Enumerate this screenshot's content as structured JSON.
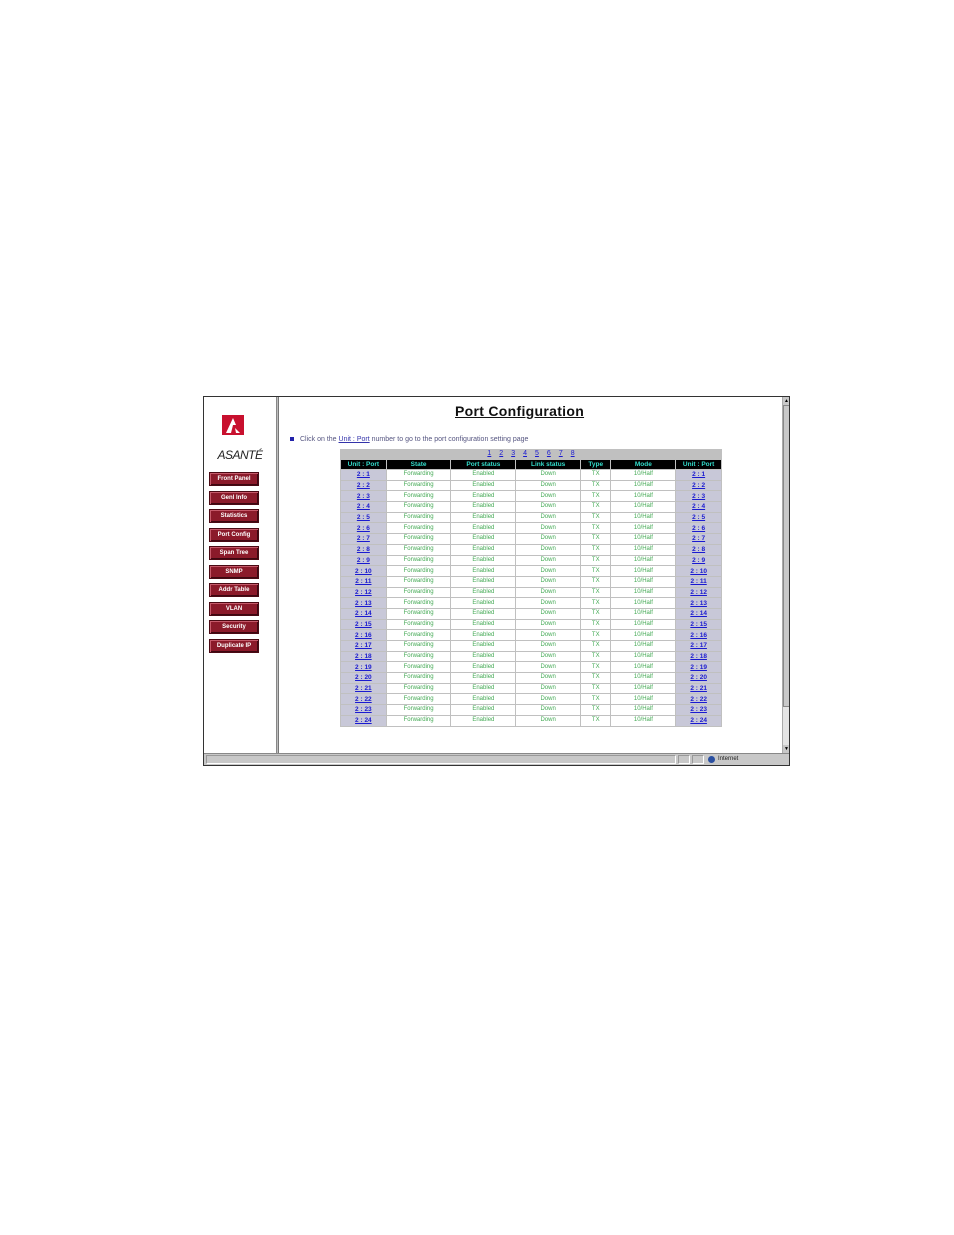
{
  "page": {
    "title": "Port Configuration",
    "instruction_prefix": "Click on the ",
    "instruction_link": "Unit : Port",
    "instruction_suffix": " number to go to the port configuration setting page"
  },
  "logo": {
    "text": "ASANTÉ",
    "icon": "asante-logo-icon"
  },
  "nav": [
    "Front Panel",
    "Genl Info",
    "Statistics",
    "Port Config",
    "Span Tree",
    "SNMP",
    "Addr Table",
    "VLAN",
    "Security",
    "Duplicate IP"
  ],
  "unit_pages": [
    "1",
    "2",
    "3",
    "4",
    "5",
    "6",
    "7",
    "8"
  ],
  "table": {
    "headers": [
      "Unit : Port",
      "State",
      "Port status",
      "Link status",
      "Type",
      "Mode",
      "Unit : Port"
    ],
    "rows": [
      [
        "2 : 1",
        "Forwarding",
        "Enabled",
        "Down",
        "TX",
        "10/Half",
        "2 : 1"
      ],
      [
        "2 : 2",
        "Forwarding",
        "Enabled",
        "Down",
        "TX",
        "10/Half",
        "2 : 2"
      ],
      [
        "2 : 3",
        "Forwarding",
        "Enabled",
        "Down",
        "TX",
        "10/Half",
        "2 : 3"
      ],
      [
        "2 : 4",
        "Forwarding",
        "Enabled",
        "Down",
        "TX",
        "10/Half",
        "2 : 4"
      ],
      [
        "2 : 5",
        "Forwarding",
        "Enabled",
        "Down",
        "TX",
        "10/Half",
        "2 : 5"
      ],
      [
        "2 : 6",
        "Forwarding",
        "Enabled",
        "Down",
        "TX",
        "10/Half",
        "2 : 6"
      ],
      [
        "2 : 7",
        "Forwarding",
        "Enabled",
        "Down",
        "TX",
        "10/Half",
        "2 : 7"
      ],
      [
        "2 : 8",
        "Forwarding",
        "Enabled",
        "Down",
        "TX",
        "10/Half",
        "2 : 8"
      ],
      [
        "2 : 9",
        "Forwarding",
        "Enabled",
        "Down",
        "TX",
        "10/Half",
        "2 : 9"
      ],
      [
        "2 : 10",
        "Forwarding",
        "Enabled",
        "Down",
        "TX",
        "10/Half",
        "2 : 10"
      ],
      [
        "2 : 11",
        "Forwarding",
        "Enabled",
        "Down",
        "TX",
        "10/Half",
        "2 : 11"
      ],
      [
        "2 : 12",
        "Forwarding",
        "Enabled",
        "Down",
        "TX",
        "10/Half",
        "2 : 12"
      ],
      [
        "2 : 13",
        "Forwarding",
        "Enabled",
        "Down",
        "TX",
        "10/Half",
        "2 : 13"
      ],
      [
        "2 : 14",
        "Forwarding",
        "Enabled",
        "Down",
        "TX",
        "10/Half",
        "2 : 14"
      ],
      [
        "2 : 15",
        "Forwarding",
        "Enabled",
        "Down",
        "TX",
        "10/Half",
        "2 : 15"
      ],
      [
        "2 : 16",
        "Forwarding",
        "Enabled",
        "Down",
        "TX",
        "10/Half",
        "2 : 16"
      ],
      [
        "2 : 17",
        "Forwarding",
        "Enabled",
        "Down",
        "TX",
        "10/Half",
        "2 : 17"
      ],
      [
        "2 : 18",
        "Forwarding",
        "Enabled",
        "Down",
        "TX",
        "10/Half",
        "2 : 18"
      ],
      [
        "2 : 19",
        "Forwarding",
        "Enabled",
        "Down",
        "TX",
        "10/Half",
        "2 : 19"
      ],
      [
        "2 : 20",
        "Forwarding",
        "Enabled",
        "Down",
        "TX",
        "10/Half",
        "2 : 20"
      ],
      [
        "2 : 21",
        "Forwarding",
        "Enabled",
        "Down",
        "TX",
        "10/Half",
        "2 : 21"
      ],
      [
        "2 : 22",
        "Forwarding",
        "Enabled",
        "Down",
        "TX",
        "10/Half",
        "2 : 22"
      ],
      [
        "2 : 23",
        "Forwarding",
        "Enabled",
        "Down",
        "TX",
        "10/Half",
        "2 : 23"
      ],
      [
        "2 : 24",
        "Forwarding",
        "Enabled",
        "Down",
        "TX",
        "10/Half",
        "2 : 24"
      ]
    ]
  },
  "statusbar": {
    "zone": "Internet",
    "zone_icon": "globe-icon"
  },
  "colors": {
    "nav_button": "#8b1a2a",
    "header_bg": "#000000",
    "header_text": "#33ddcc",
    "cell_text": "#44aa55",
    "link": "#1a1ad0",
    "logo_red": "#c8102e"
  }
}
